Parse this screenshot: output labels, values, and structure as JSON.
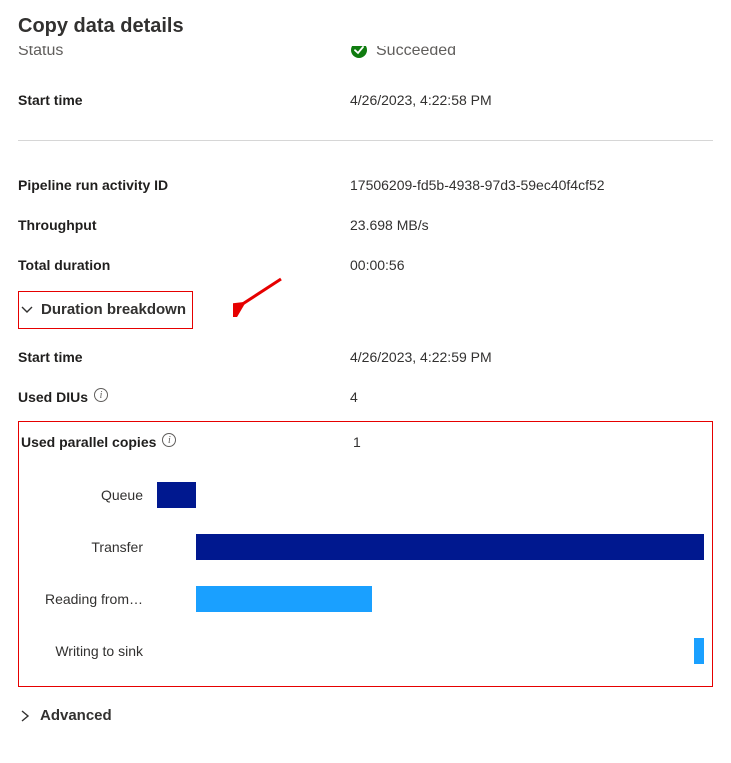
{
  "title": "Copy data details",
  "status": {
    "label": "Status",
    "value": "Succeeded",
    "color": "#107c10"
  },
  "start_time": {
    "label": "Start time",
    "value": "4/26/2023, 4:22:58 PM"
  },
  "pipeline": {
    "label": "Pipeline run activity ID",
    "value": "17506209-fd5b-4938-97d3-59ec40f4cf52"
  },
  "throughput": {
    "label": "Throughput",
    "value": "23.698 MB/s"
  },
  "total_duration": {
    "label": "Total duration",
    "value": "00:00:56"
  },
  "breakdown_label": "Duration breakdown",
  "bd_start_time": {
    "label": "Start time",
    "value": "4/26/2023, 4:22:59 PM"
  },
  "dius": {
    "label": "Used DIUs",
    "value": "4"
  },
  "upc": {
    "label": "Used parallel copies",
    "value": "1"
  },
  "advanced_label": "Advanced",
  "chart_data": {
    "type": "bar",
    "title": "",
    "xlabel": "",
    "ylabel": "",
    "xlim": [
      0,
      56
    ],
    "categories": [
      "Queue",
      "Transfer",
      "Reading from…",
      "Writing to sink"
    ],
    "series": [
      {
        "name": "Queue",
        "start": 0,
        "length": 4,
        "color": "#00188f"
      },
      {
        "name": "Transfer",
        "start": 4,
        "length": 52,
        "color": "#00188f"
      },
      {
        "name": "Reading from…",
        "start": 4,
        "length": 18,
        "color": "#1aa0ff"
      },
      {
        "name": "Writing to sink",
        "start": 55,
        "length": 1,
        "color": "#1aa0ff"
      }
    ]
  }
}
